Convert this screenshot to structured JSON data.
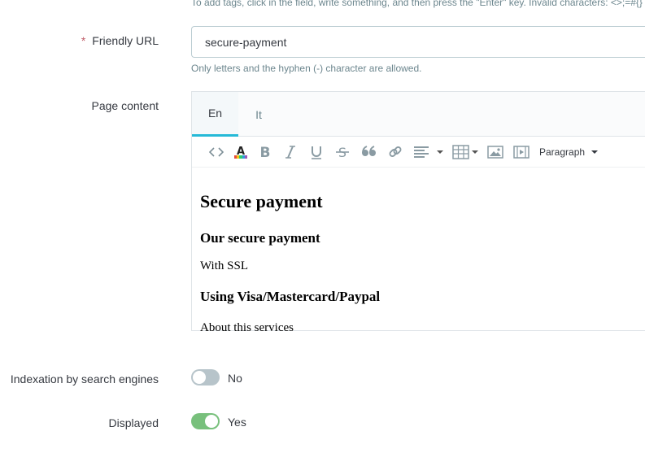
{
  "tags_help": "To add tags, click in the field, write something, and then press the \"Enter\" key. Invalid characters: <>;=#{}",
  "friendly_url": {
    "required_mark": "*",
    "label": "Friendly URL",
    "value": "secure-payment",
    "help": "Only letters and the hyphen (-) character are allowed."
  },
  "page_content": {
    "label": "Page content",
    "tabs": [
      {
        "label": "En",
        "active": true
      },
      {
        "label": "It",
        "active": false
      }
    ],
    "toolbar": {
      "icons": [
        "code-icon",
        "text-color-icon",
        "bold-icon",
        "italic-icon",
        "underline-icon",
        "strikethrough-icon",
        "blockquote-icon",
        "link-icon",
        "align-icon",
        "table-icon",
        "image-icon",
        "media-icon"
      ],
      "format_select": "Paragraph"
    },
    "body": {
      "h1": "Secure payment",
      "h2": "Our secure payment",
      "p1": "With SSL",
      "h3": "Using Visa/Mastercard/Paypal",
      "p2": "About this services"
    }
  },
  "indexation": {
    "label": "Indexation by search engines",
    "state": "No",
    "enabled": false
  },
  "displayed": {
    "label": "Displayed",
    "state": "Yes",
    "enabled": true
  },
  "colors": {
    "accent": "#25b9d7",
    "toggle_on": "#78c07c",
    "toggle_off": "#b7c4ca",
    "required": "#c05c67"
  }
}
